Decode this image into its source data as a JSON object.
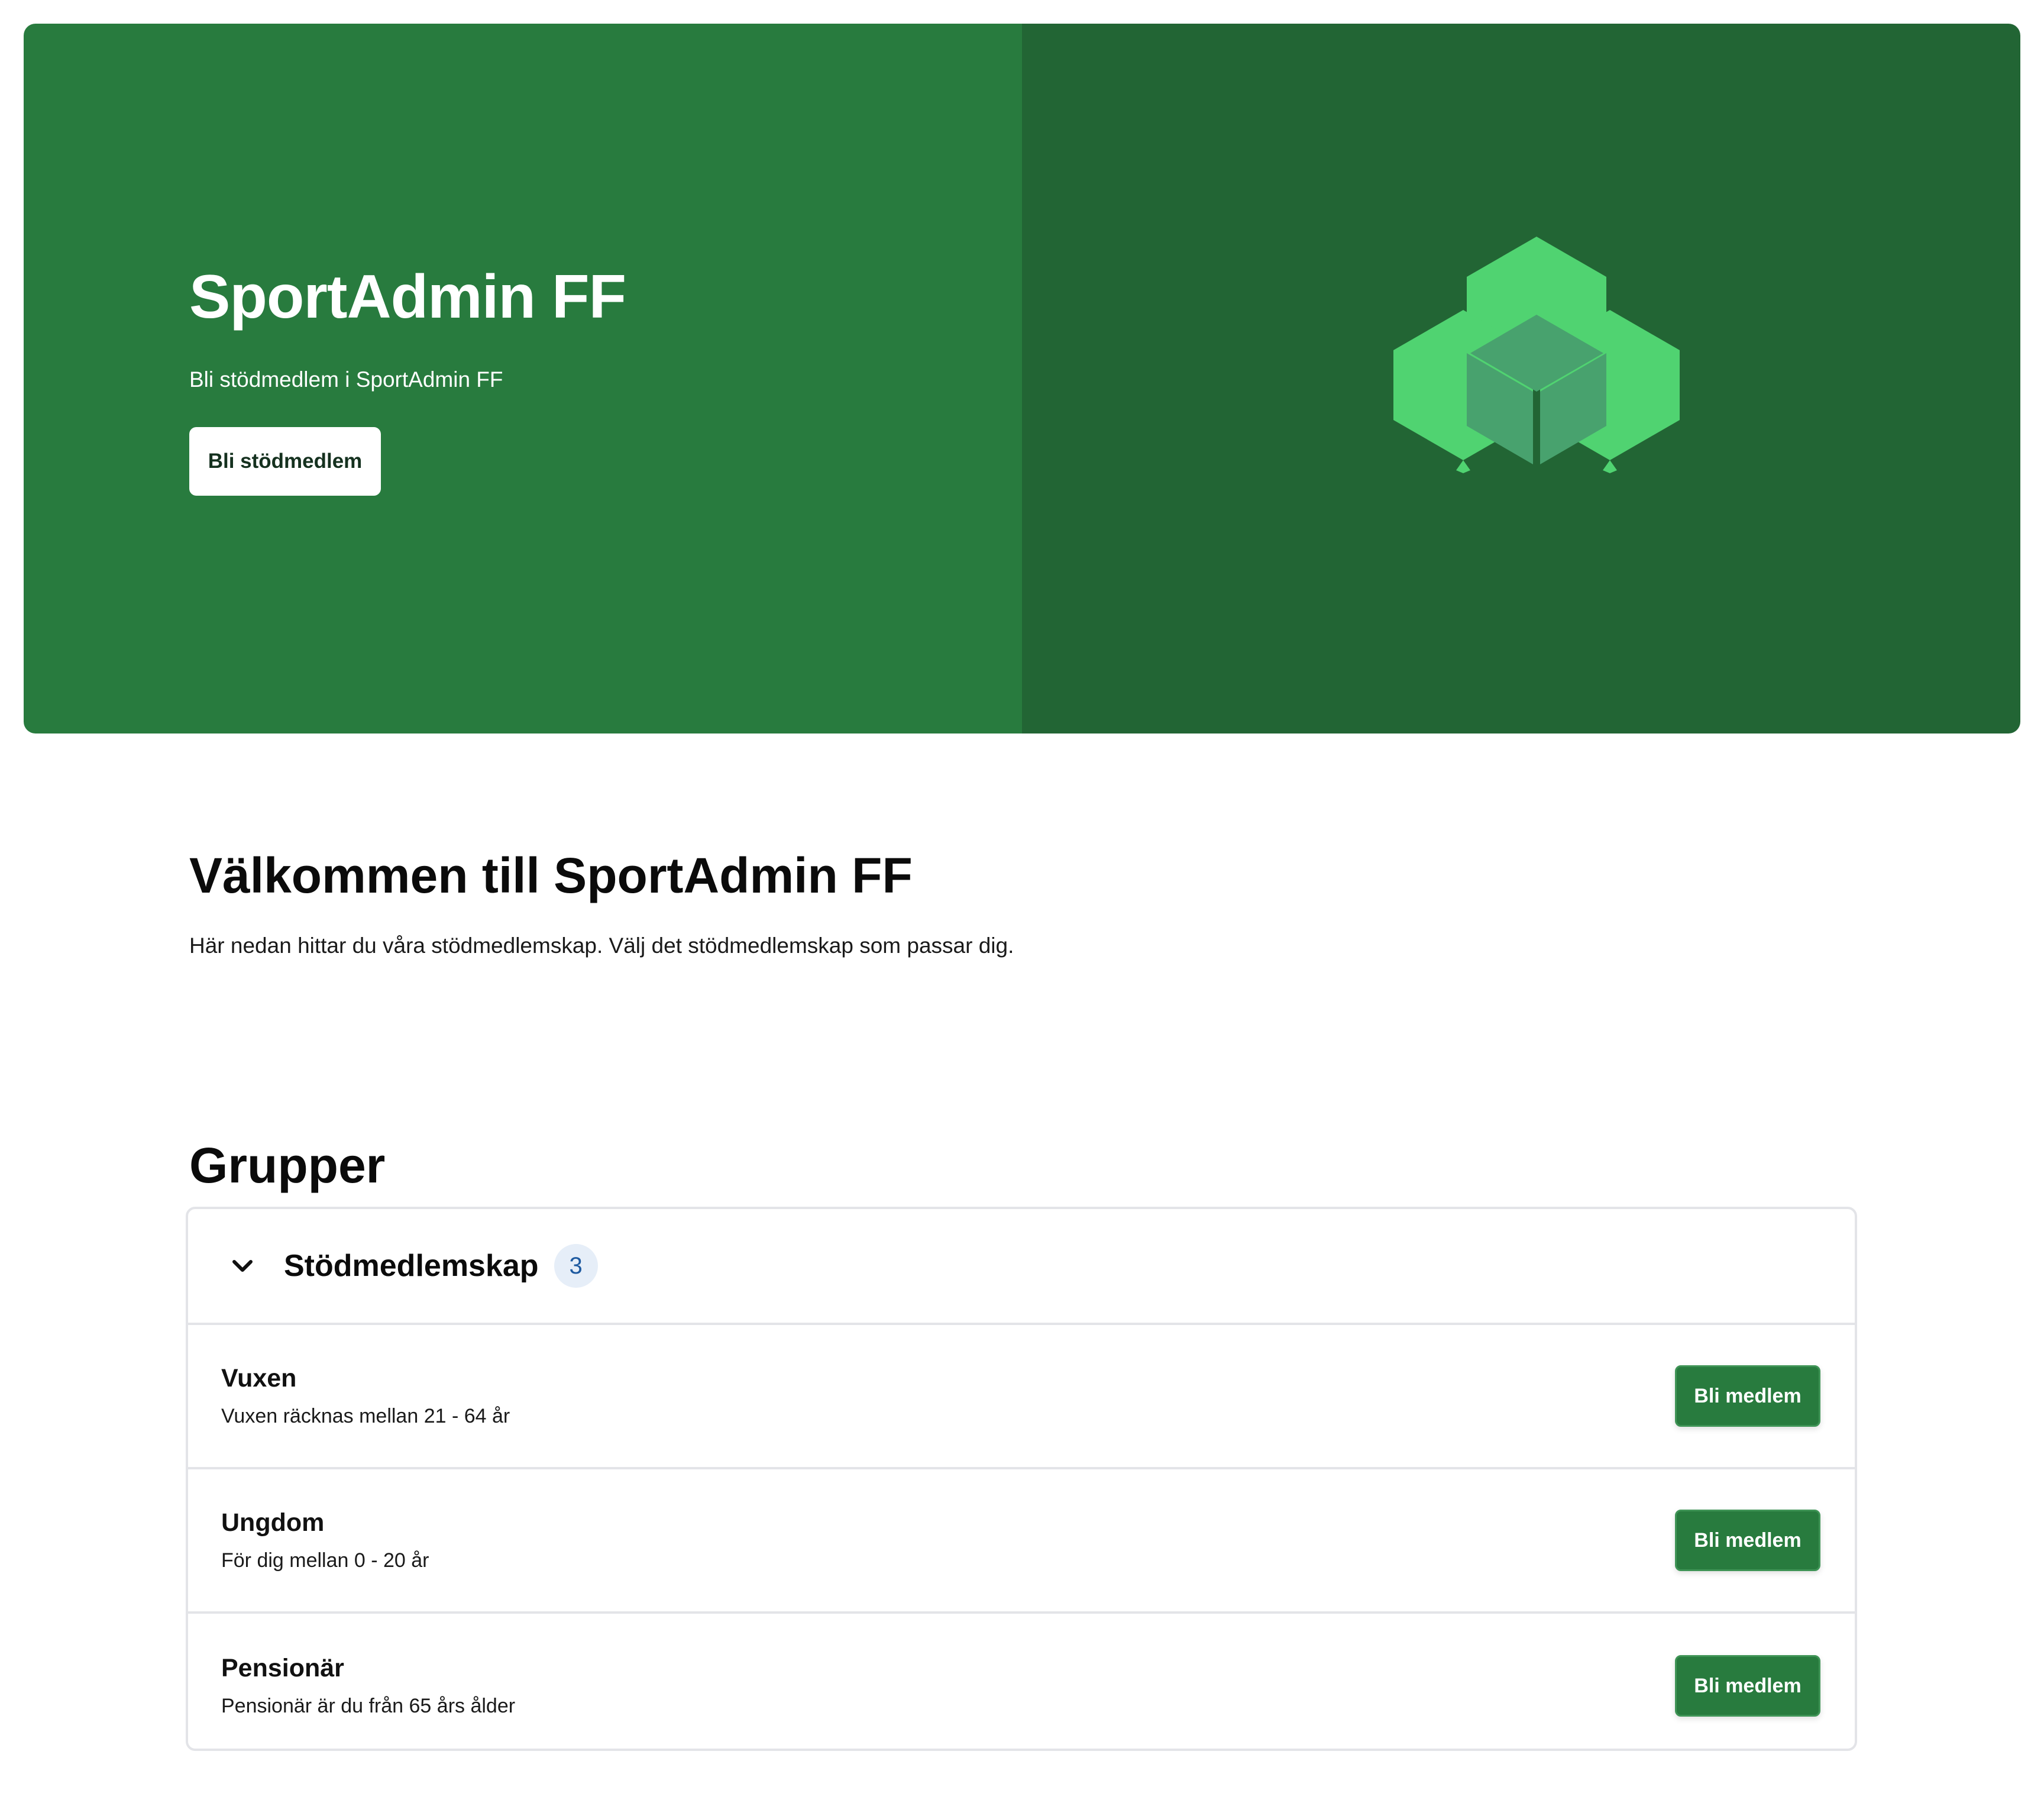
{
  "hero": {
    "title": "SportAdmin FF",
    "subtitle": "Bli stödmedlem i SportAdmin FF",
    "button_label": "Bli stödmedlem",
    "logo_icon": "hexagon-cluster-logo",
    "colors": {
      "left": "#287b3e",
      "right": "#226534",
      "logo_hex": "#50d371",
      "logo_overlap": "#48a26e"
    }
  },
  "welcome": {
    "title": "Välkommen till SportAdmin FF",
    "text": "Här nedan hittar du våra stödmedlemskap. Välj det stödmedlemskap som passar dig."
  },
  "groups": {
    "title": "Grupper",
    "group": {
      "name": "Stödmedlemskap",
      "count": "3",
      "expanded": true,
      "memberships": [
        {
          "title": "Vuxen",
          "description": "Vuxen räcknas mellan 21 - 64 år",
          "button_label": "Bli medlem"
        },
        {
          "title": "Ungdom",
          "description": "För dig mellan 0 - 20 år",
          "button_label": "Bli medlem"
        },
        {
          "title": "Pensionär",
          "description": "Pensionär är du från 65 års ålder",
          "button_label": "Bli medlem"
        }
      ]
    }
  },
  "accent_color": "#287b3e"
}
